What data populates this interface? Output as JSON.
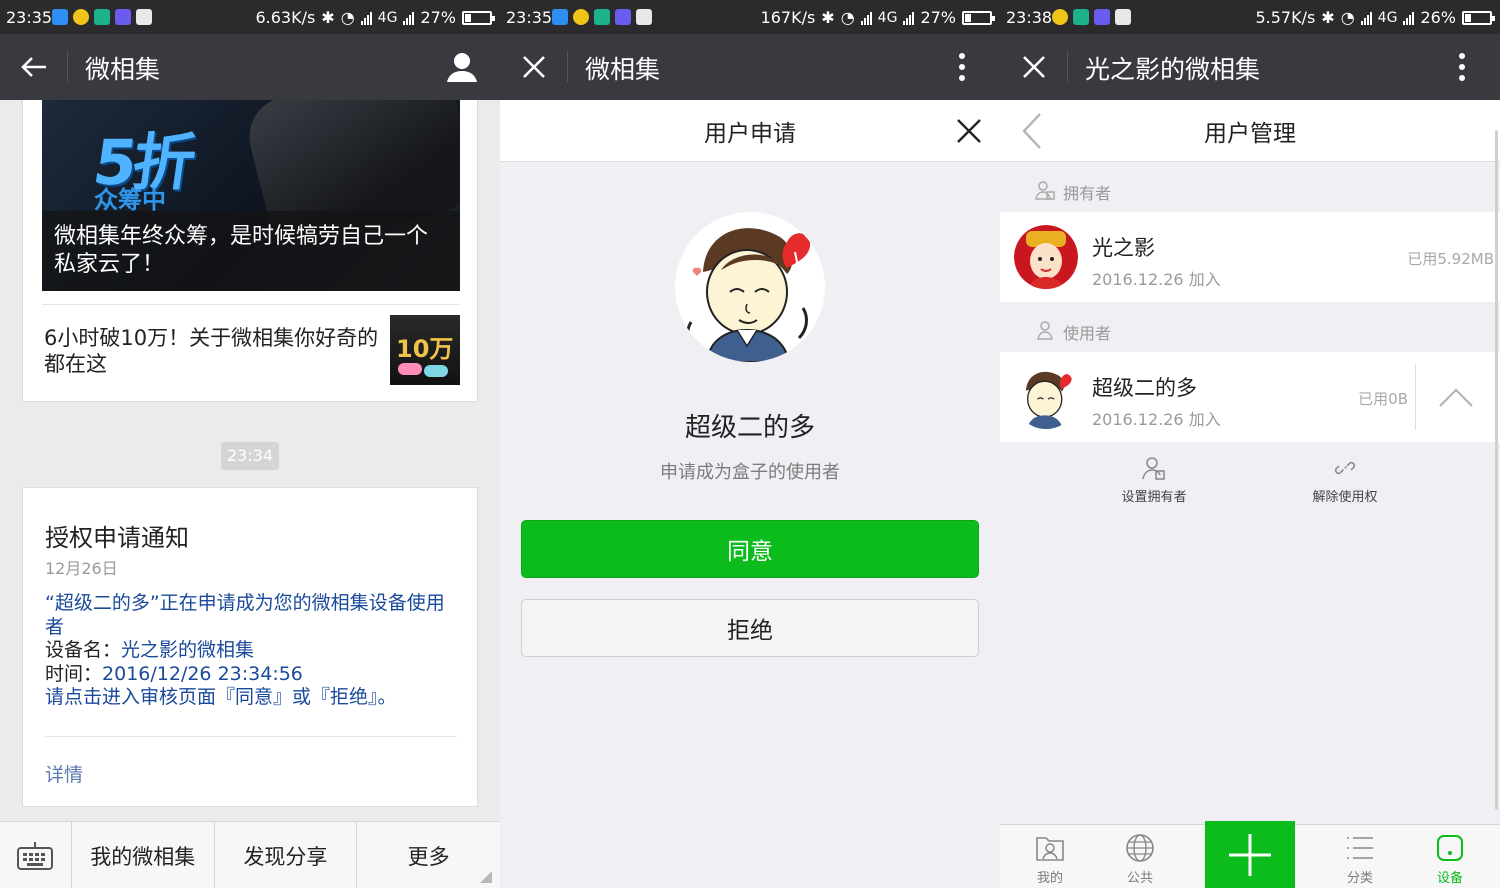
{
  "panel1": {
    "status": {
      "time": "23:35",
      "speed": "6.63K/s",
      "network": "4G",
      "battery": "27%",
      "battery_level": 0.27
    },
    "title": "微相集",
    "hero": {
      "badge": "5折",
      "sub": "众筹中",
      "caption": "微相集年终众筹，是时候犒劳自己一个私家云了！"
    },
    "news_item": {
      "text": "6小时破10万！关于微相集你好奇的都在这",
      "thumb_text": "10万"
    },
    "time_chip": "23:34",
    "notice": {
      "title": "授权申请通知",
      "date": "12月26日",
      "line1": "“超级二的多”正在申请成为您的微相集设备使用者",
      "device_label": "设备名：",
      "device_value": "光之影的微相集",
      "time_label": "时间：",
      "time_value": "2016/12/26 23:34:56",
      "instruction": "请点击进入审核页面『同意』或『拒绝』。",
      "detail": "详情"
    },
    "menu": [
      "我的微相集",
      "发现分享",
      "更多"
    ]
  },
  "panel2": {
    "status": {
      "time": "23:35",
      "speed": "167K/s",
      "network": "4G",
      "battery": "27%",
      "battery_level": 0.27
    },
    "title": "微相集",
    "sheet_title": "用户申请",
    "name": "超级二的多",
    "subtitle": "申请成为盒子的使用者",
    "agree": "同意",
    "reject": "拒绝"
  },
  "panel3": {
    "status": {
      "time": "23:38",
      "speed": "5.57K/s",
      "network": "4G",
      "battery": "26%",
      "battery_level": 0.26
    },
    "title": "光之影的微相集",
    "page_title": "用户管理",
    "owner_section": "拥有者",
    "user_section": "使用者",
    "owner": {
      "name": "光之影",
      "joined": "2016.12.26 加入",
      "used": "已用5.92MB"
    },
    "user": {
      "name": "超级二的多",
      "joined": "2016.12.26 加入",
      "used": "已用0B"
    },
    "actions": [
      "设置拥有者",
      "解除使用权"
    ],
    "tabs": [
      "我的",
      "公共",
      "分类",
      "设备"
    ]
  },
  "colors": {
    "accent_green": "#0bbc1c",
    "titlebar": "#393a3f",
    "link_blue": "#1a4a9b"
  },
  "icons": [
    "back-arrow-icon",
    "user-icon",
    "close-icon",
    "more-vert-icon",
    "keyboard-icon",
    "chevron-left-icon",
    "chevron-up-icon",
    "plus-icon"
  ]
}
